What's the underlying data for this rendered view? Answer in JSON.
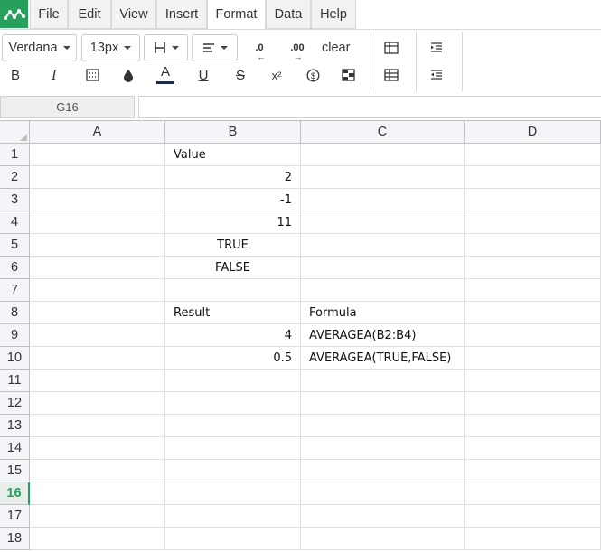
{
  "menu": {
    "items": [
      {
        "label": "File"
      },
      {
        "label": "Edit"
      },
      {
        "label": "View"
      },
      {
        "label": "Insert"
      },
      {
        "label": "Format"
      },
      {
        "label": "Data"
      },
      {
        "label": "Help"
      }
    ],
    "active": "Format"
  },
  "toolbar": {
    "font_family": "Verdana",
    "font_size": "13px",
    "clear_label": "clear",
    "icons": [
      "borders-icon",
      "align-icon",
      "decrease-decimals-icon",
      "increase-decimals-icon",
      "bold-icon",
      "italic-icon",
      "fill-pattern-icon",
      "fill-color-icon",
      "text-color-icon",
      "underline-icon",
      "strikethrough-icon",
      "superscript-icon",
      "currency-icon",
      "conditional-format-icon",
      "table-icon",
      "merge-icon",
      "indent-icon",
      "outdent-icon"
    ],
    "bold_glyph": "B",
    "italic_glyph": "I",
    "text_color_glyph": "A",
    "underline_glyph": "U",
    "strike_glyph": "S",
    "superscript_glyph": "x²",
    "decrease_decimals_glyph": ".0",
    "increase_decimals_glyph": ".00",
    "accent_color": "#27a05b",
    "text_color_underline": "#1a2b4c"
  },
  "formula_bar": {
    "cell_ref": "G16",
    "value": ""
  },
  "grid": {
    "columns": [
      "A",
      "B",
      "C",
      "D"
    ],
    "rows": [
      "1",
      "2",
      "3",
      "4",
      "5",
      "6",
      "7",
      "8",
      "9",
      "10",
      "11",
      "12",
      "13",
      "14",
      "15",
      "16",
      "17",
      "18"
    ],
    "selected_row": "16",
    "cells": {
      "B1": "Value",
      "B2": "2",
      "B3": "-1",
      "B4": "11",
      "B5": "TRUE",
      "B6": "FALSE",
      "B8": "Result",
      "C8": "Formula",
      "B9": "4",
      "C9": "AVERAGEA(B2:B4)",
      "B10": "0.5",
      "C10": "AVERAGEA(TRUE,FALSE)"
    }
  }
}
